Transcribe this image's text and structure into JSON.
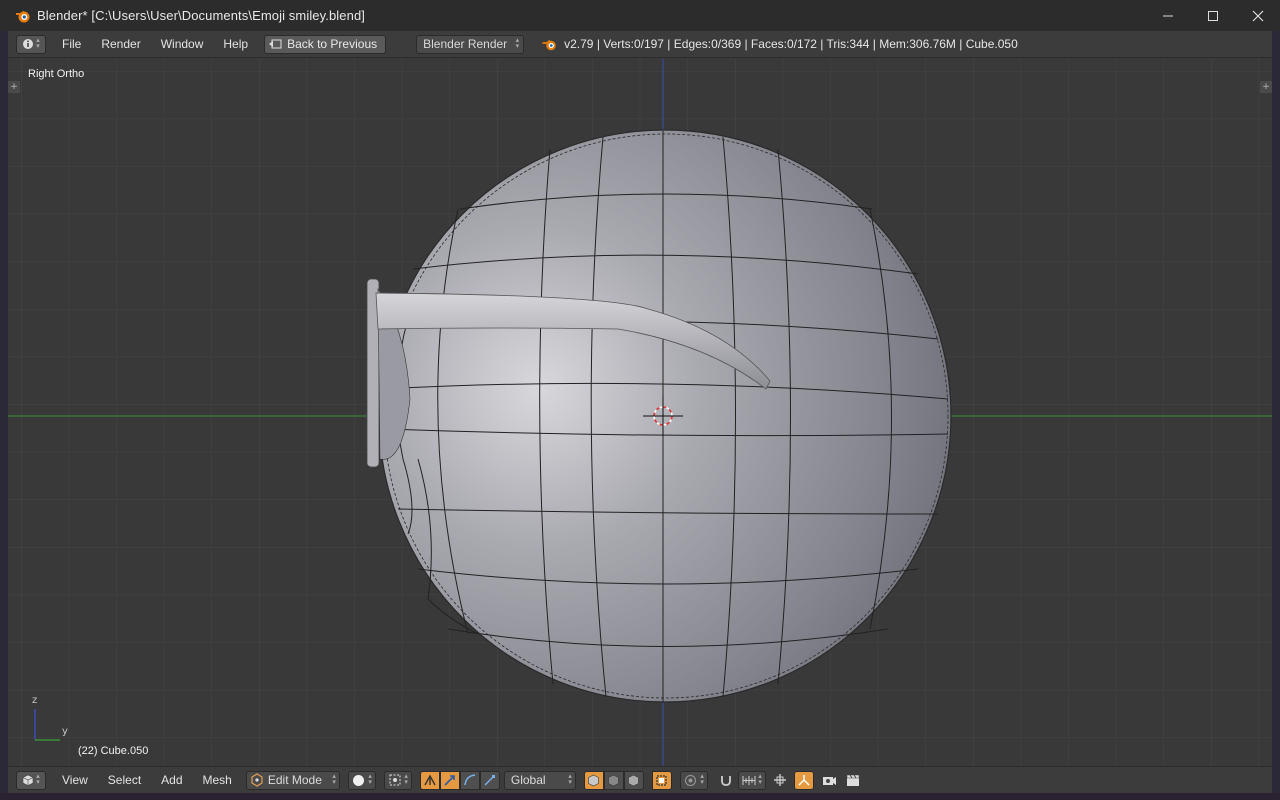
{
  "window": {
    "title": "Blender* [C:\\Users\\User\\Documents\\Emoji smiley.blend]",
    "minimize_icon": "minimize-icon",
    "maximize_icon": "maximize-icon",
    "close_icon": "close-icon"
  },
  "info_header": {
    "menus": [
      "File",
      "Render",
      "Window",
      "Help"
    ],
    "back_button": "Back to Previous",
    "render_engine": "Blender Render",
    "stats": "v2.79 | Verts:0/197 | Edges:0/369 | Faces:0/172 | Tris:344 | Mem:306.76M | Cube.050"
  },
  "viewport": {
    "view_name": "Right Ortho",
    "object_info": "(22) Cube.050",
    "axis_labels": {
      "z": "z",
      "y": "y"
    }
  },
  "view3d_header": {
    "menus": [
      "View",
      "Select",
      "Add",
      "Mesh"
    ],
    "mode": "Edit Mode",
    "orientation": "Global"
  },
  "colors": {
    "accent": "#e59940",
    "viewport_bg": "#393939",
    "grid_line": "#454545",
    "x_axis": "#3a8f34",
    "z_axis": "#3a4fb0",
    "mesh": "#9c9ca6"
  }
}
